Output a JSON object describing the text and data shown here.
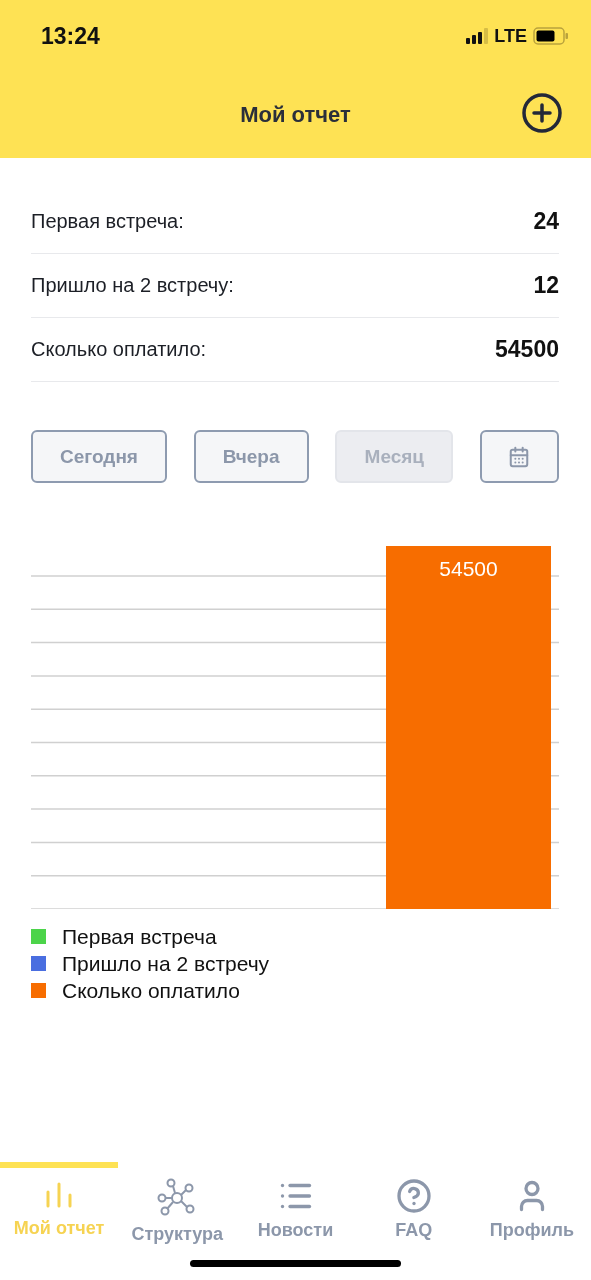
{
  "status_bar": {
    "time": "13:24",
    "network": "LTE"
  },
  "header": {
    "title": "Мой отчет"
  },
  "stats": [
    {
      "label": "Первая встреча:",
      "value": "24"
    },
    {
      "label": "Пришло на 2 встречу:",
      "value": "12"
    },
    {
      "label": "Сколько оплатило:",
      "value": "54500"
    }
  ],
  "periods": [
    {
      "label": "Сегодня",
      "selected": false
    },
    {
      "label": "Вчера",
      "selected": false
    },
    {
      "label": "Месяц",
      "selected": true
    }
  ],
  "chart": {
    "bar_label": "54500",
    "legend": [
      {
        "name": "Первая встреча",
        "color": "#4cd44a"
      },
      {
        "name": "Пришло на 2 встречу",
        "color": "#4a6ee0"
      },
      {
        "name": "Сколько оплатило",
        "color": "#f76d00"
      }
    ]
  },
  "tabs": [
    {
      "label": "Мой отчет",
      "selected": true
    },
    {
      "label": "Структура",
      "selected": false
    },
    {
      "label": "Новости",
      "selected": false
    },
    {
      "label": "FAQ",
      "selected": false
    },
    {
      "label": "Профиль",
      "selected": false
    }
  ]
}
